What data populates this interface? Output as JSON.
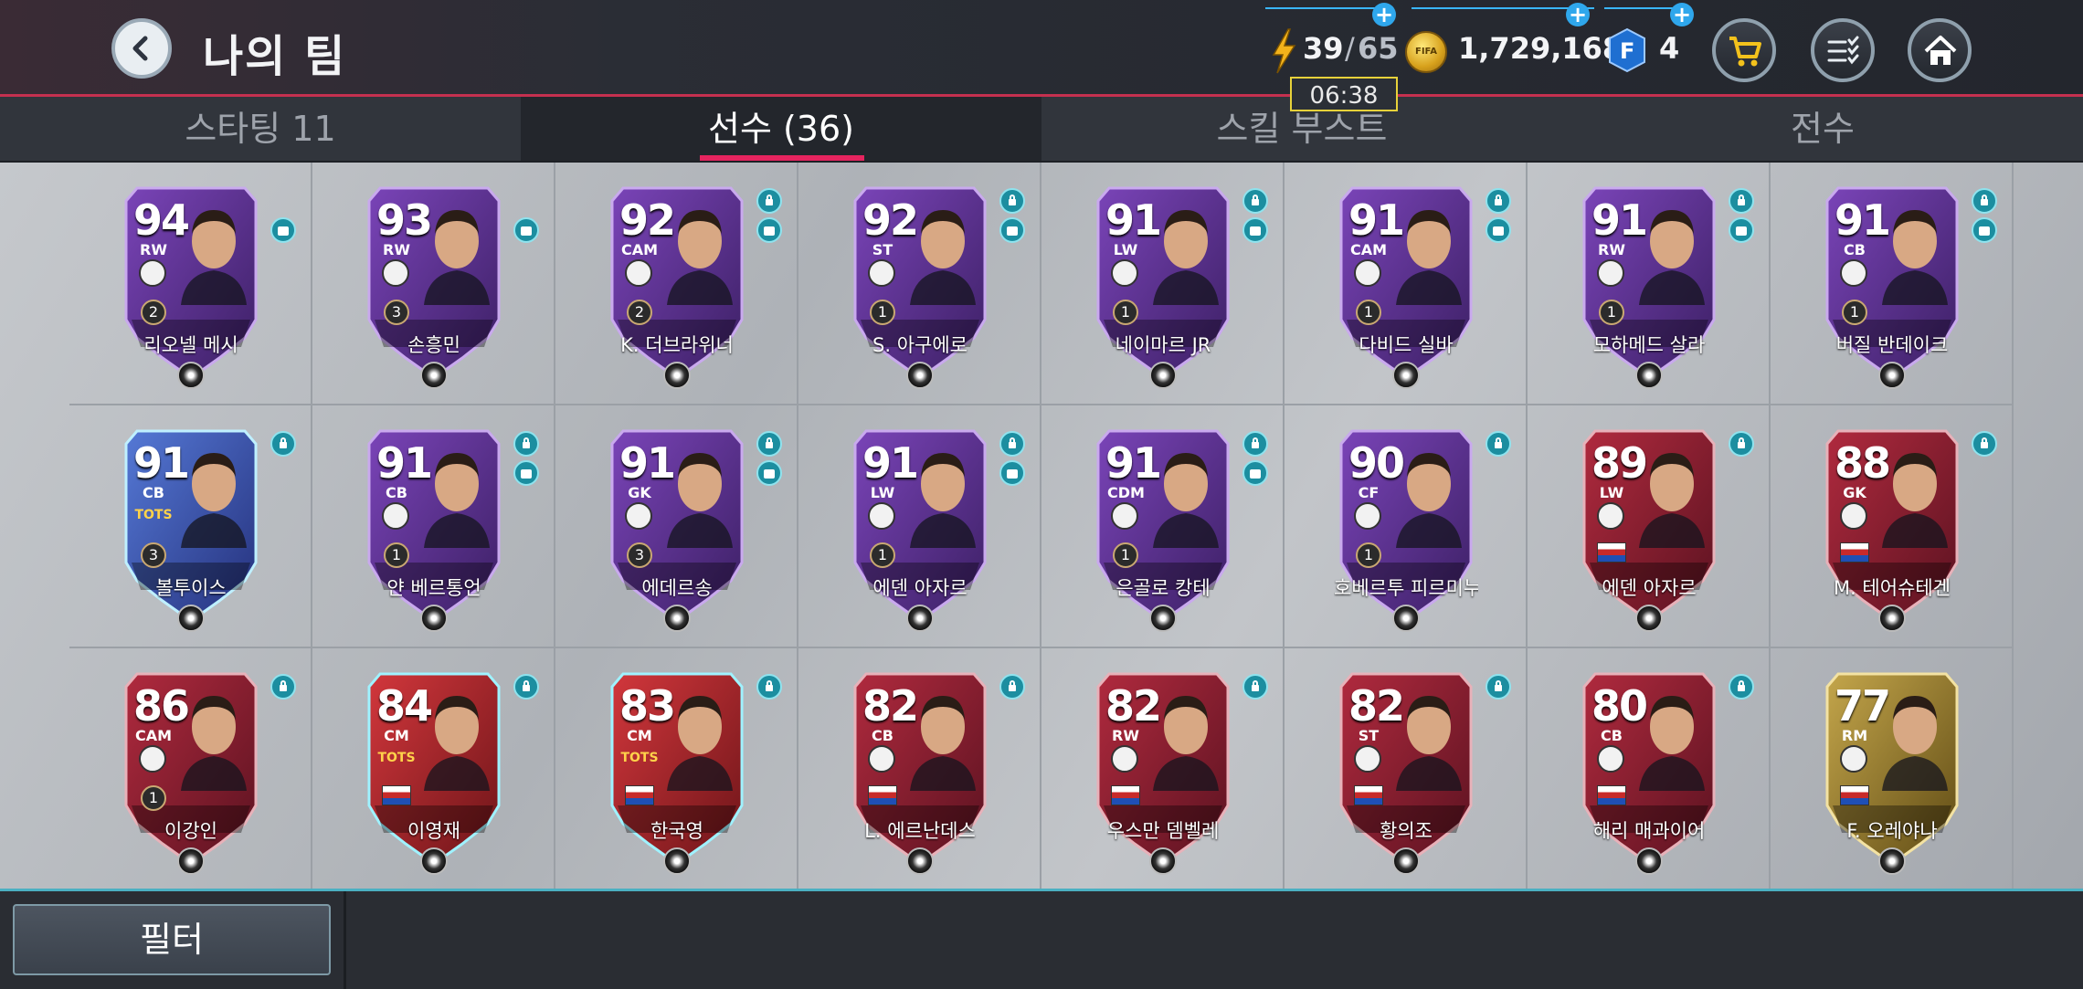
{
  "header": {
    "title": "나의 팀",
    "energy": {
      "current": "39",
      "separator": "/",
      "max": "65"
    },
    "timer": "06:38",
    "coins": "1,729,168",
    "fifa_points": "4",
    "icons": [
      "back-arrow-icon",
      "lightning-icon",
      "fifa-coin-icon",
      "fifa-points-icon",
      "cart-icon",
      "list-check-icon",
      "home-icon"
    ]
  },
  "tabs": [
    {
      "label": "스타팅 11",
      "active": false
    },
    {
      "label": "선수 (36)",
      "active": true
    },
    {
      "label": "스킬 부스트",
      "active": false
    },
    {
      "label": "전수",
      "active": false
    }
  ],
  "players": [
    {
      "rating": "94",
      "pos": "RW",
      "rank": "2",
      "name": "리오넬 메시",
      "theme": "purple",
      "locked": false,
      "shirt": true
    },
    {
      "rating": "93",
      "pos": "RW",
      "rank": "3",
      "name": "손흥민",
      "theme": "purple",
      "locked": false,
      "shirt": true
    },
    {
      "rating": "92",
      "pos": "CAM",
      "rank": "2",
      "name": "K. 더브라위너",
      "theme": "purple",
      "locked": true,
      "shirt": true
    },
    {
      "rating": "92",
      "pos": "ST",
      "rank": "1",
      "name": "S. 아구에로",
      "theme": "purple",
      "locked": true,
      "shirt": true
    },
    {
      "rating": "91",
      "pos": "LW",
      "rank": "1",
      "name": "네이마르 JR",
      "theme": "purple",
      "locked": true,
      "shirt": true
    },
    {
      "rating": "91",
      "pos": "CAM",
      "rank": "1",
      "name": "다비드 실바",
      "theme": "purple",
      "locked": true,
      "shirt": true
    },
    {
      "rating": "91",
      "pos": "RW",
      "rank": "1",
      "name": "모하메드 살라",
      "theme": "purple",
      "locked": true,
      "shirt": true
    },
    {
      "rating": "91",
      "pos": "CB",
      "rank": "1",
      "name": "버질 반데이크",
      "theme": "purple",
      "locked": true,
      "shirt": true
    },
    {
      "rating": "91",
      "pos": "CB",
      "rank": "3",
      "name": "볼투이스",
      "theme": "tots-blue",
      "tots": "TOTS",
      "locked": true,
      "shirt": false
    },
    {
      "rating": "91",
      "pos": "CB",
      "rank": "1",
      "name": "얀 베르통언",
      "theme": "purple",
      "locked": true,
      "shirt": true
    },
    {
      "rating": "91",
      "pos": "GK",
      "rank": "3",
      "name": "에데르송",
      "theme": "purple",
      "locked": true,
      "shirt": true
    },
    {
      "rating": "91",
      "pos": "LW",
      "rank": "1",
      "name": "에덴 아자르",
      "theme": "purple",
      "locked": true,
      "shirt": true
    },
    {
      "rating": "91",
      "pos": "CDM",
      "rank": "1",
      "name": "은골로 캉테",
      "theme": "purple",
      "locked": true,
      "shirt": true
    },
    {
      "rating": "90",
      "pos": "CF",
      "rank": "1",
      "name": "호베르투 피르미누",
      "theme": "purple",
      "locked": true,
      "shirt": false
    },
    {
      "rating": "89",
      "pos": "LW",
      "rank": "",
      "name": "에덴 아자르",
      "theme": "red",
      "locked": true,
      "shirt": false
    },
    {
      "rating": "88",
      "pos": "GK",
      "rank": "",
      "name": "M. 테어슈테겐",
      "theme": "red",
      "locked": true,
      "shirt": false
    },
    {
      "rating": "86",
      "pos": "CAM",
      "rank": "1",
      "name": "이강인",
      "theme": "red",
      "locked": true,
      "shirt": false
    },
    {
      "rating": "84",
      "pos": "CM",
      "rank": "",
      "name": "이영재",
      "theme": "tots-red",
      "tots": "TOTS",
      "locked": true,
      "shirt": false
    },
    {
      "rating": "83",
      "pos": "CM",
      "rank": "",
      "name": "한국영",
      "theme": "tots-red",
      "tots": "TOTS",
      "locked": true,
      "shirt": false
    },
    {
      "rating": "82",
      "pos": "CB",
      "rank": "",
      "name": "L. 에르난데스",
      "theme": "red",
      "locked": true,
      "shirt": false
    },
    {
      "rating": "82",
      "pos": "RW",
      "rank": "",
      "name": "우스만 뎀벨레",
      "theme": "red",
      "locked": true,
      "shirt": false
    },
    {
      "rating": "82",
      "pos": "ST",
      "rank": "",
      "name": "황의조",
      "theme": "red",
      "locked": true,
      "shirt": false
    },
    {
      "rating": "80",
      "pos": "CB",
      "rank": "",
      "name": "해리 매과이어",
      "theme": "red",
      "locked": true,
      "shirt": false
    },
    {
      "rating": "77",
      "pos": "RM",
      "rank": "",
      "name": "F. 오레야나",
      "theme": "gold",
      "locked": false,
      "shirt": false
    }
  ],
  "filter_label": "필터",
  "colors": {
    "accent": "#e6245f",
    "purple": "#5b2c8c",
    "red": "#8e1b2c",
    "gold": "#a38a3c",
    "tots_blue": "#3b5fbf"
  }
}
